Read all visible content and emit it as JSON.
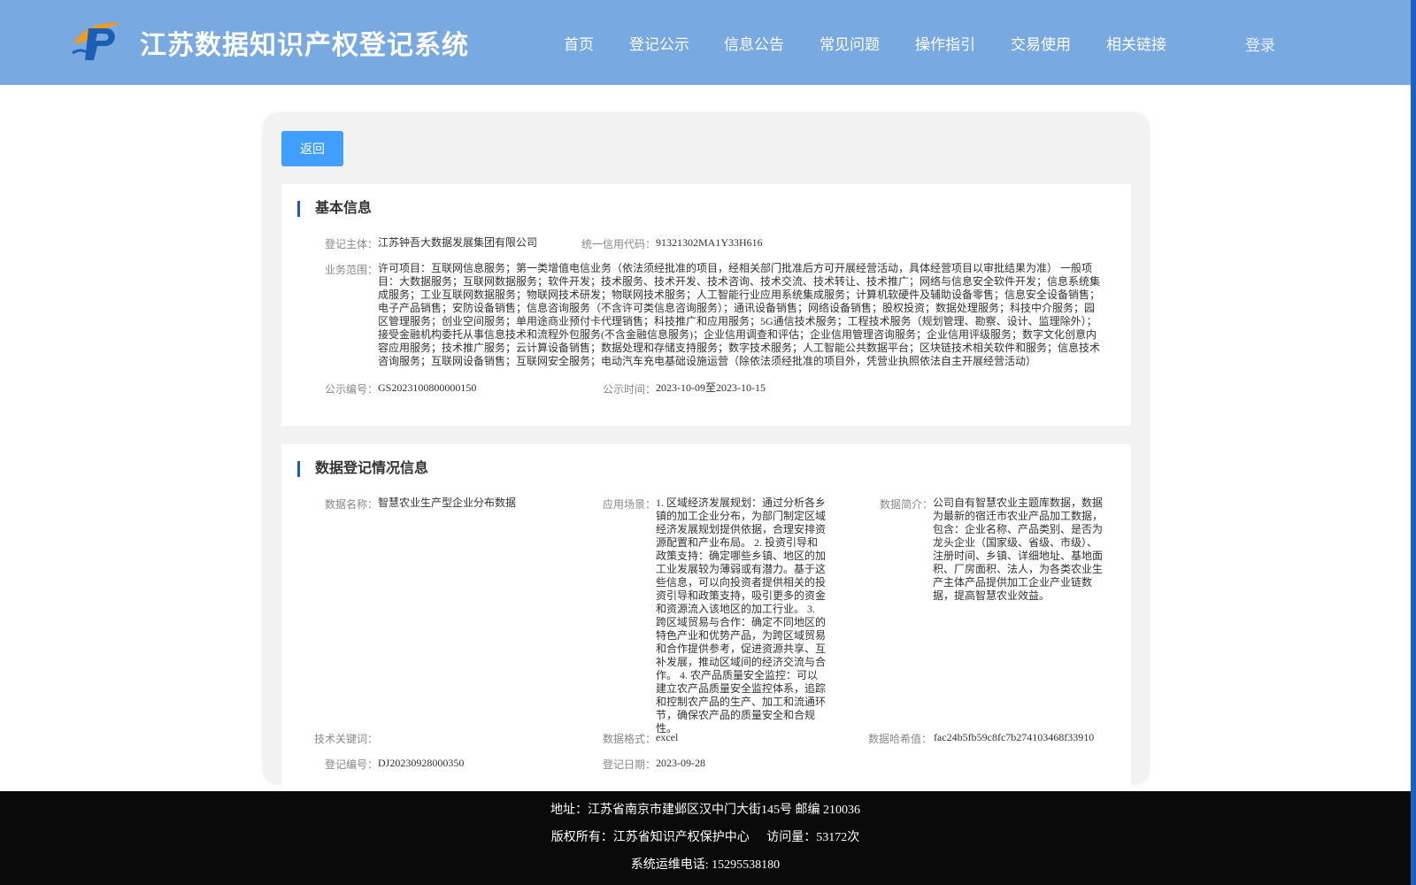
{
  "header": {
    "title": "江苏数据知识产权登记系统",
    "nav": [
      "首页",
      "登记公示",
      "信息公告",
      "常见问题",
      "操作指引",
      "交易使用",
      "相关链接"
    ],
    "login": "登录"
  },
  "back_button": "返回",
  "basic_info": {
    "title": "基本信息",
    "subject_label": "登记主体：",
    "subject_value": "江苏钟吾大数据发展集团有限公司",
    "credit_label": "统一信用代码：",
    "credit_value": "91321302MA1Y33H616",
    "scope_label": "业务范围：",
    "scope_value": "许可项目：互联网信息服务；第一类增值电信业务（依法须经批准的项目，经相关部门批准后方可开展经营活动，具体经营项目以审批结果为准） 一般项目：大数据服务；互联网数据服务；软件开发；技术服务、技术开发、技术咨询、技术交流、技术转让、技术推广；网络与信息安全软件开发；信息系统集成服务；工业互联网数据服务；物联网技术研发；物联网技术服务；人工智能行业应用系统集成服务；计算机软硬件及辅助设备零售；信息安全设备销售；电子产品销售；安防设备销售；信息咨询服务（不含许可类信息咨询服务）；通讯设备销售；网络设备销售；股权投资；数据处理服务；科技中介服务；园区管理服务；创业空间服务；单用途商业预付卡代理销售；科技推广和应用服务；5G通信技术服务；工程技术服务（规划管理、勘察、设计、监理除外）；接受金融机构委托从事信息技术和流程外包服务(不含金融信息服务)；企业信用调查和评估；企业信用管理咨询服务；企业信用评级服务；数字文化创意内容应用服务；技术推广服务；云计算设备销售；数据处理和存储支持服务；数字技术服务；人工智能公共数据平台；区块链技术相关软件和服务；信息技术咨询服务；互联网设备销售；互联网安全服务；电动汽车充电基础设施运营（除依法须经批准的项目外，凭营业执照依法自主开展经营活动）",
    "pub_no_label": "公示编号：",
    "pub_no_value": "GS2023100800000150",
    "pub_time_label": "公示时间：",
    "pub_time_value": "2023-10-09至2023-10-15"
  },
  "data_info": {
    "title": "数据登记情况信息",
    "name_label": "数据名称：",
    "name_value": "智慧农业生产型企业分布数据",
    "scene_label": "应用场景：",
    "scene_value": "1. 区域经济发展规划：通过分析各乡镇的加工企业分布，为部门制定区域经济发展规划提供依据，合理安排资源配置和产业布局。 2. 投资引导和政策支持：确定哪些乡镇、地区的加工业发展较为薄弱或有潜力。基于这些信息，可以向投资者提供相关的投资引导和政策支持，吸引更多的资金和资源流入该地区的加工行业。 3. 跨区域贸易与合作：确定不同地区的特色产业和优势产品，为跨区域贸易和合作提供参考，促进资源共享、互补发展，推动区域间的经济交流与合作。 4. 农产品质量安全监控：可以建立农产品质量安全监控体系，追踪和控制农产品的生产、加工和流通环节，确保农产品的质量安全和合规性。",
    "intro_label": "数据简介：",
    "intro_value": "公司自有智慧农业主题库数据，数据为最新的宿迁市农业产品加工数据，包含：企业名称、产品类别、是否为龙头企业（国家级、省级、市级）、注册时间、乡镇、详细地址、基地面积、厂房面积、法人，为各类农业生产主体产品提供加工企业产业链数据，提高智慧农业效益。",
    "keywords_label": "技术关键词：",
    "keywords_value": "",
    "format_label": "数据格式：",
    "format_value": "excel",
    "hash_label": "数据哈希值：",
    "hash_value": "fac24b5fb59c8fc7b274103468f33910",
    "reg_no_label": "登记编号：",
    "reg_no_value": "DJ20230928000350",
    "reg_date_label": "登记日期：",
    "reg_date_value": "2023-09-28"
  },
  "footer": {
    "address": "地址：江苏省南京市建邺区汉中门大街145号 邮编 210036",
    "copyright": "版权所有：江苏省知识产权保护中心",
    "visits": "访问量：53172次",
    "hotline": "系统运维电话: 15295538180"
  },
  "colors": {
    "header_bg": "#78a9e0",
    "button_bg": "#409eff",
    "accent_bar": "#1e5db8",
    "footer_bg": "#0a0a0a"
  }
}
